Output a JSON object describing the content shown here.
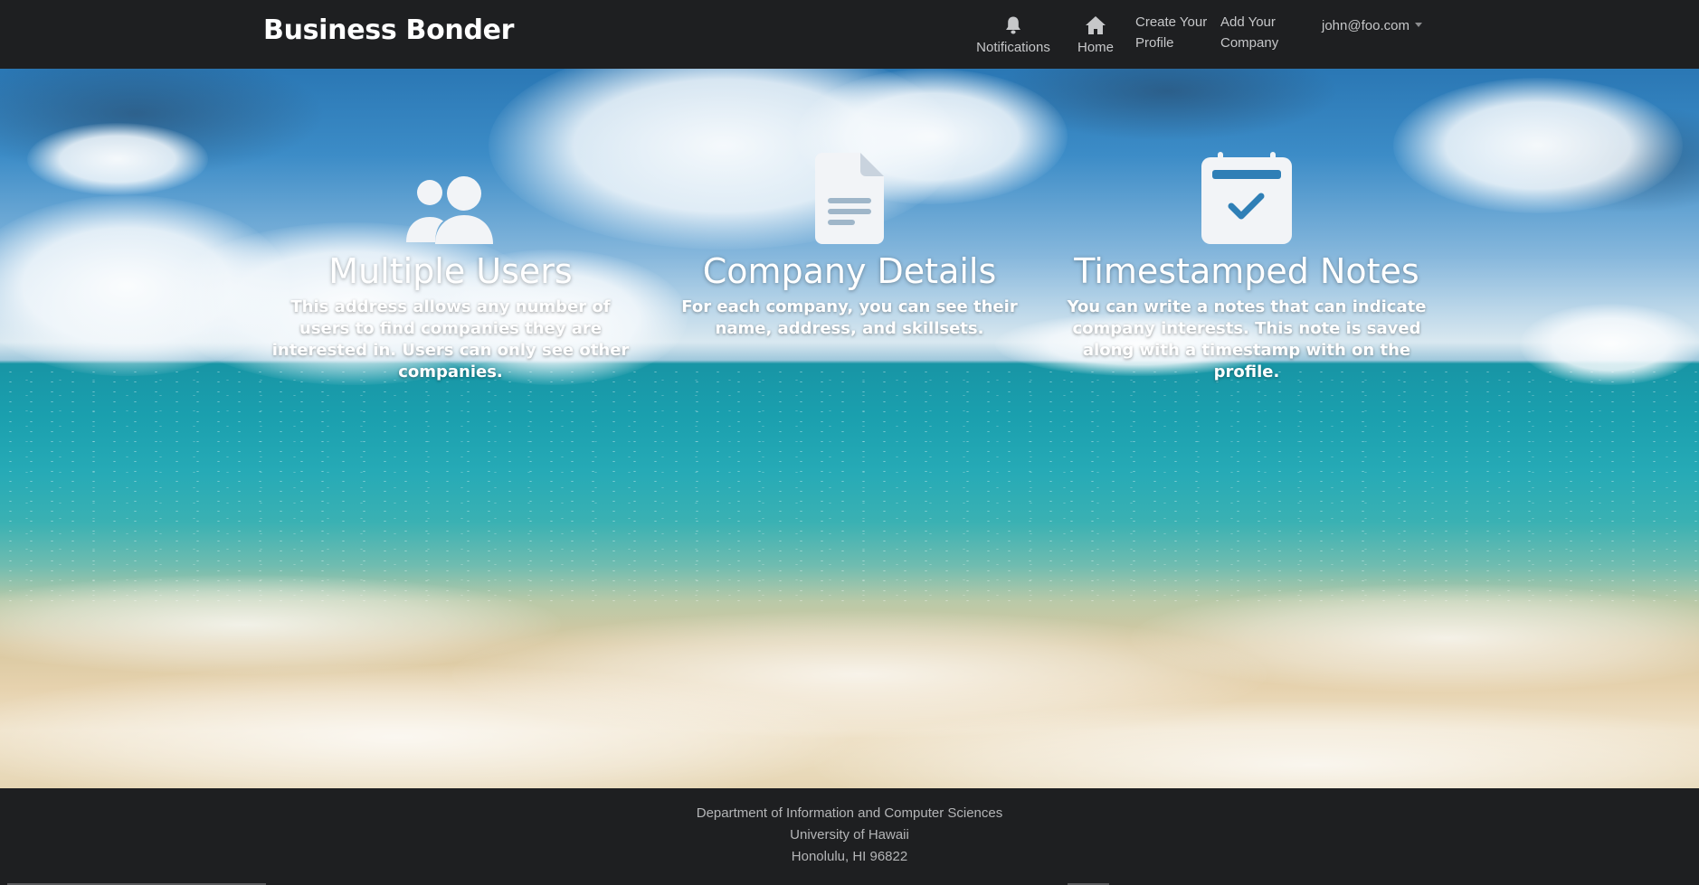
{
  "navbar": {
    "brand": "Business Bonder",
    "notifications_label": "Notifications",
    "home_label": "Home",
    "create_profile_line1": "Create Your",
    "create_profile_line2": "Profile",
    "add_company_line1": "Add Your",
    "add_company_line2": "Company",
    "user_email": "john@foo.com"
  },
  "features": [
    {
      "icon": "users-icon",
      "title": "Multiple Users",
      "description": "This address allows any number of users to find companies they are interested in. Users can only see other companies."
    },
    {
      "icon": "document-icon",
      "title": "Company Details",
      "description": "For each company, you can see their name, address, and skillsets."
    },
    {
      "icon": "calendar-check-icon",
      "title": "Timestamped Notes",
      "description": "You can write a notes that can indicate company interests. This note is saved along with a timestamp with on the profile."
    }
  ],
  "footer": {
    "line1": "Department of Information and Computer Sciences",
    "line2": "University of Hawaii",
    "line3": "Honolulu, HI 96822"
  },
  "colors": {
    "navbar_bg": "#1e1f21",
    "nav_text": "#c6c7c9",
    "icon_fill": "#f2f4f7",
    "footer_text": "#b4b5b7"
  }
}
